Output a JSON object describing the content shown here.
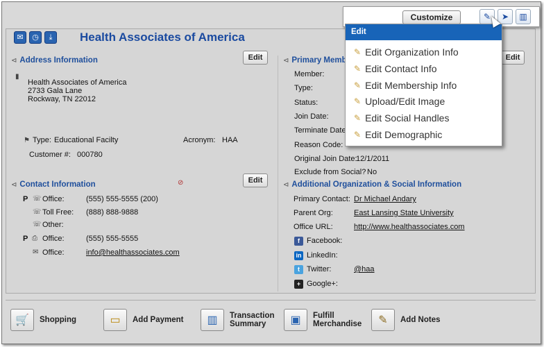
{
  "header": {
    "org_name": "Health Associates of America",
    "icons": [
      "mail-icon",
      "clock-icon",
      "inbox-icon"
    ]
  },
  "toolbar": {
    "customize_label": "Customize",
    "tools": [
      "pencil-icon",
      "pointer-icon",
      "chart-icon"
    ]
  },
  "edit_menu": {
    "title": "Edit",
    "items": [
      "Edit Organization Info",
      "Edit Contact Info",
      "Edit Membership Info",
      "Upload/Edit Image",
      "Edit Social Handles",
      "Edit Demographic"
    ]
  },
  "address": {
    "title": "Address Information",
    "edit_label": "Edit",
    "line1": "Health Associates of America",
    "line2": "2733 Gala Lane",
    "line3": "Rockway, TN 22012",
    "type_label": "Type:",
    "type_value": "Educational Facilty",
    "acronym_label": "Acronym:",
    "acronym_value": "HAA",
    "customer_label": "Customer #:",
    "customer_value": "000780"
  },
  "contact": {
    "title": "Contact Information",
    "edit_label": "Edit",
    "rows": [
      {
        "flag": "P",
        "label": "Office:",
        "value": "(555) 555-5555 (200)"
      },
      {
        "flag": "",
        "label": "Toll Free:",
        "value": "(888) 888-9888"
      },
      {
        "flag": "",
        "label": "Other:",
        "value": ""
      },
      {
        "flag": "P",
        "label": "Office:",
        "value": "(555) 555-5555"
      },
      {
        "flag": "",
        "label": "Office:",
        "value": "info@healthassociates.com"
      }
    ]
  },
  "membership": {
    "title": "Primary Memb",
    "edit_label": "Edit",
    "labels": [
      "Member:",
      "Type:",
      "Status:",
      "Join Date:",
      "Terminate Date",
      "Reason Code:"
    ],
    "original_join_label": "Original Join Date:",
    "original_join_value": "12/1/2011",
    "exclude_label": "Exclude from Social?",
    "exclude_value": "No"
  },
  "additional": {
    "title": "Additional Organization & Social Information",
    "primary_contact_label": "Primary Contact:",
    "primary_contact_value": "Dr Michael Andary",
    "parent_org_label": "Parent Org:",
    "parent_org_value": "East Lansing State University",
    "office_url_label": "Office URL:",
    "office_url_value": "http://www.healthassociates.com",
    "social": [
      {
        "label": "Facebook:",
        "value": ""
      },
      {
        "label": "LinkedIn:",
        "value": ""
      },
      {
        "label": "Twitter:",
        "value": "@haa"
      },
      {
        "label": "Google+:",
        "value": ""
      }
    ]
  },
  "bottom_actions": {
    "shopping": "Shopping",
    "add_payment": "Add Payment",
    "transaction_1": "Transaction",
    "transaction_2": "Summary",
    "fulfill_1": "Fulfill",
    "fulfill_2": "Merchandise",
    "add_notes": "Add Notes"
  },
  "colors": {
    "accent": "#1f4f9c",
    "menu_header": "#1864b8",
    "background": "#d9d9d9"
  }
}
